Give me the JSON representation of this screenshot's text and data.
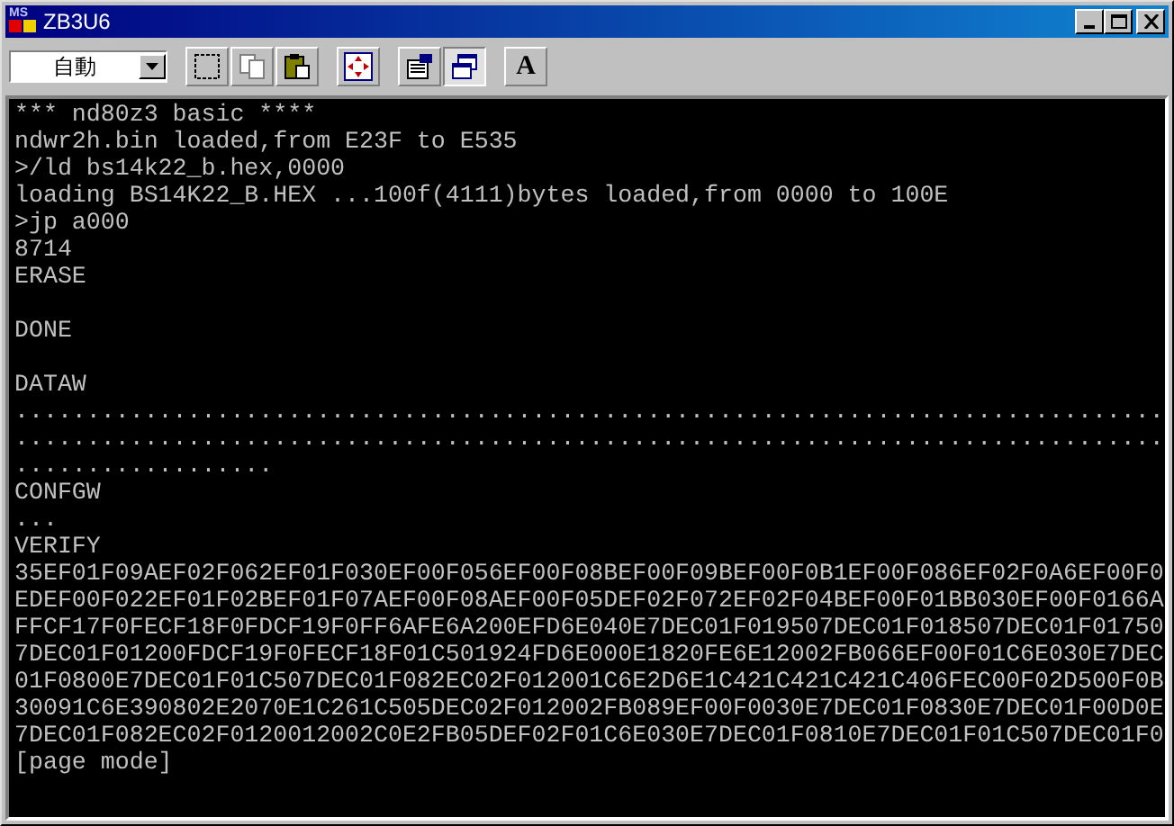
{
  "window": {
    "title": "ZB3U6",
    "logo": "MS"
  },
  "toolbar": {
    "font_dropdown": {
      "value": "自動"
    },
    "buttons": [
      {
        "kind": "mark",
        "selected": false
      },
      {
        "kind": "copy",
        "selected": false
      },
      {
        "kind": "paste",
        "selected": false
      },
      {
        "kind": "fullscreen",
        "selected": false
      },
      {
        "kind": "properties",
        "selected": false
      },
      {
        "kind": "background",
        "selected": true
      },
      {
        "kind": "font",
        "label": "A",
        "selected": false
      }
    ]
  },
  "terminal": {
    "lines": [
      {
        "kind": "text",
        "text": "*** nd80z3 basic ****"
      },
      {
        "kind": "text",
        "text": "ndwr2h.bin loaded,from E23F to E535"
      },
      {
        "kind": "text",
        "text": ">/ld bs14k22_b.hex,0000"
      },
      {
        "kind": "text",
        "text": "loading BS14K22_B.HEX ...100f(4111)bytes loaded,from 0000 to 100E"
      },
      {
        "kind": "text",
        "text": ">jp a000"
      },
      {
        "kind": "text",
        "text": "8714"
      },
      {
        "kind": "text",
        "text": "ERASE"
      },
      {
        "kind": "blank"
      },
      {
        "kind": "text",
        "text": "DONE"
      },
      {
        "kind": "blank"
      },
      {
        "kind": "text",
        "text": "DATAW"
      },
      {
        "kind": "text",
        "text": "................................................................................"
      },
      {
        "kind": "text",
        "text": "................................................................................"
      },
      {
        "kind": "text",
        "text": ".................."
      },
      {
        "kind": "text",
        "text": "CONFGW"
      },
      {
        "kind": "text",
        "text": "..."
      },
      {
        "kind": "text",
        "text": "VERIFY"
      },
      {
        "kind": "text",
        "text": "35EF01F09AEF02F062EF01F030EF00F056EF00F08BEF00F09BEF00F0B1EF00F086EF02F0A6EF00F0"
      },
      {
        "kind": "text",
        "text": "EDEF00F022EF01F02BEF01F07AEF00F08AEF00F05DEF02F072EF02F04BEF00F01BB030EF00F0166A"
      },
      {
        "kind": "text",
        "text": "FFCF17F0FECF18F0FDCF19F0FF6AFE6A200EFD6E040E7DEC01F019507DEC01F018507DEC01F01750"
      },
      {
        "kind": "text",
        "text": "7DEC01F01200FDCF19F0FECF18F01C501924FD6E000E1820FE6E12002FB066EF00F01C6E030E7DEC"
      },
      {
        "kind": "text",
        "text": "01F0800E7DEC01F01C507DEC01F082EC02F012001C6E2D6E1C421C421C421C406FEC00F02D500F0B"
      },
      {
        "kind": "text",
        "text": "30091C6E390802E2070E1C261C505DEC02F012002FB089EF00F0030E7DEC01F0830E7DEC01F00D0E"
      },
      {
        "kind": "text",
        "text": "7DEC01F082EC02F0120012002C0E2FB05DEF02F01C6E030E7DEC01F0810E7DEC01F01C507DEC01F0"
      },
      {
        "kind": "text",
        "text": "[page mode]"
      }
    ]
  }
}
